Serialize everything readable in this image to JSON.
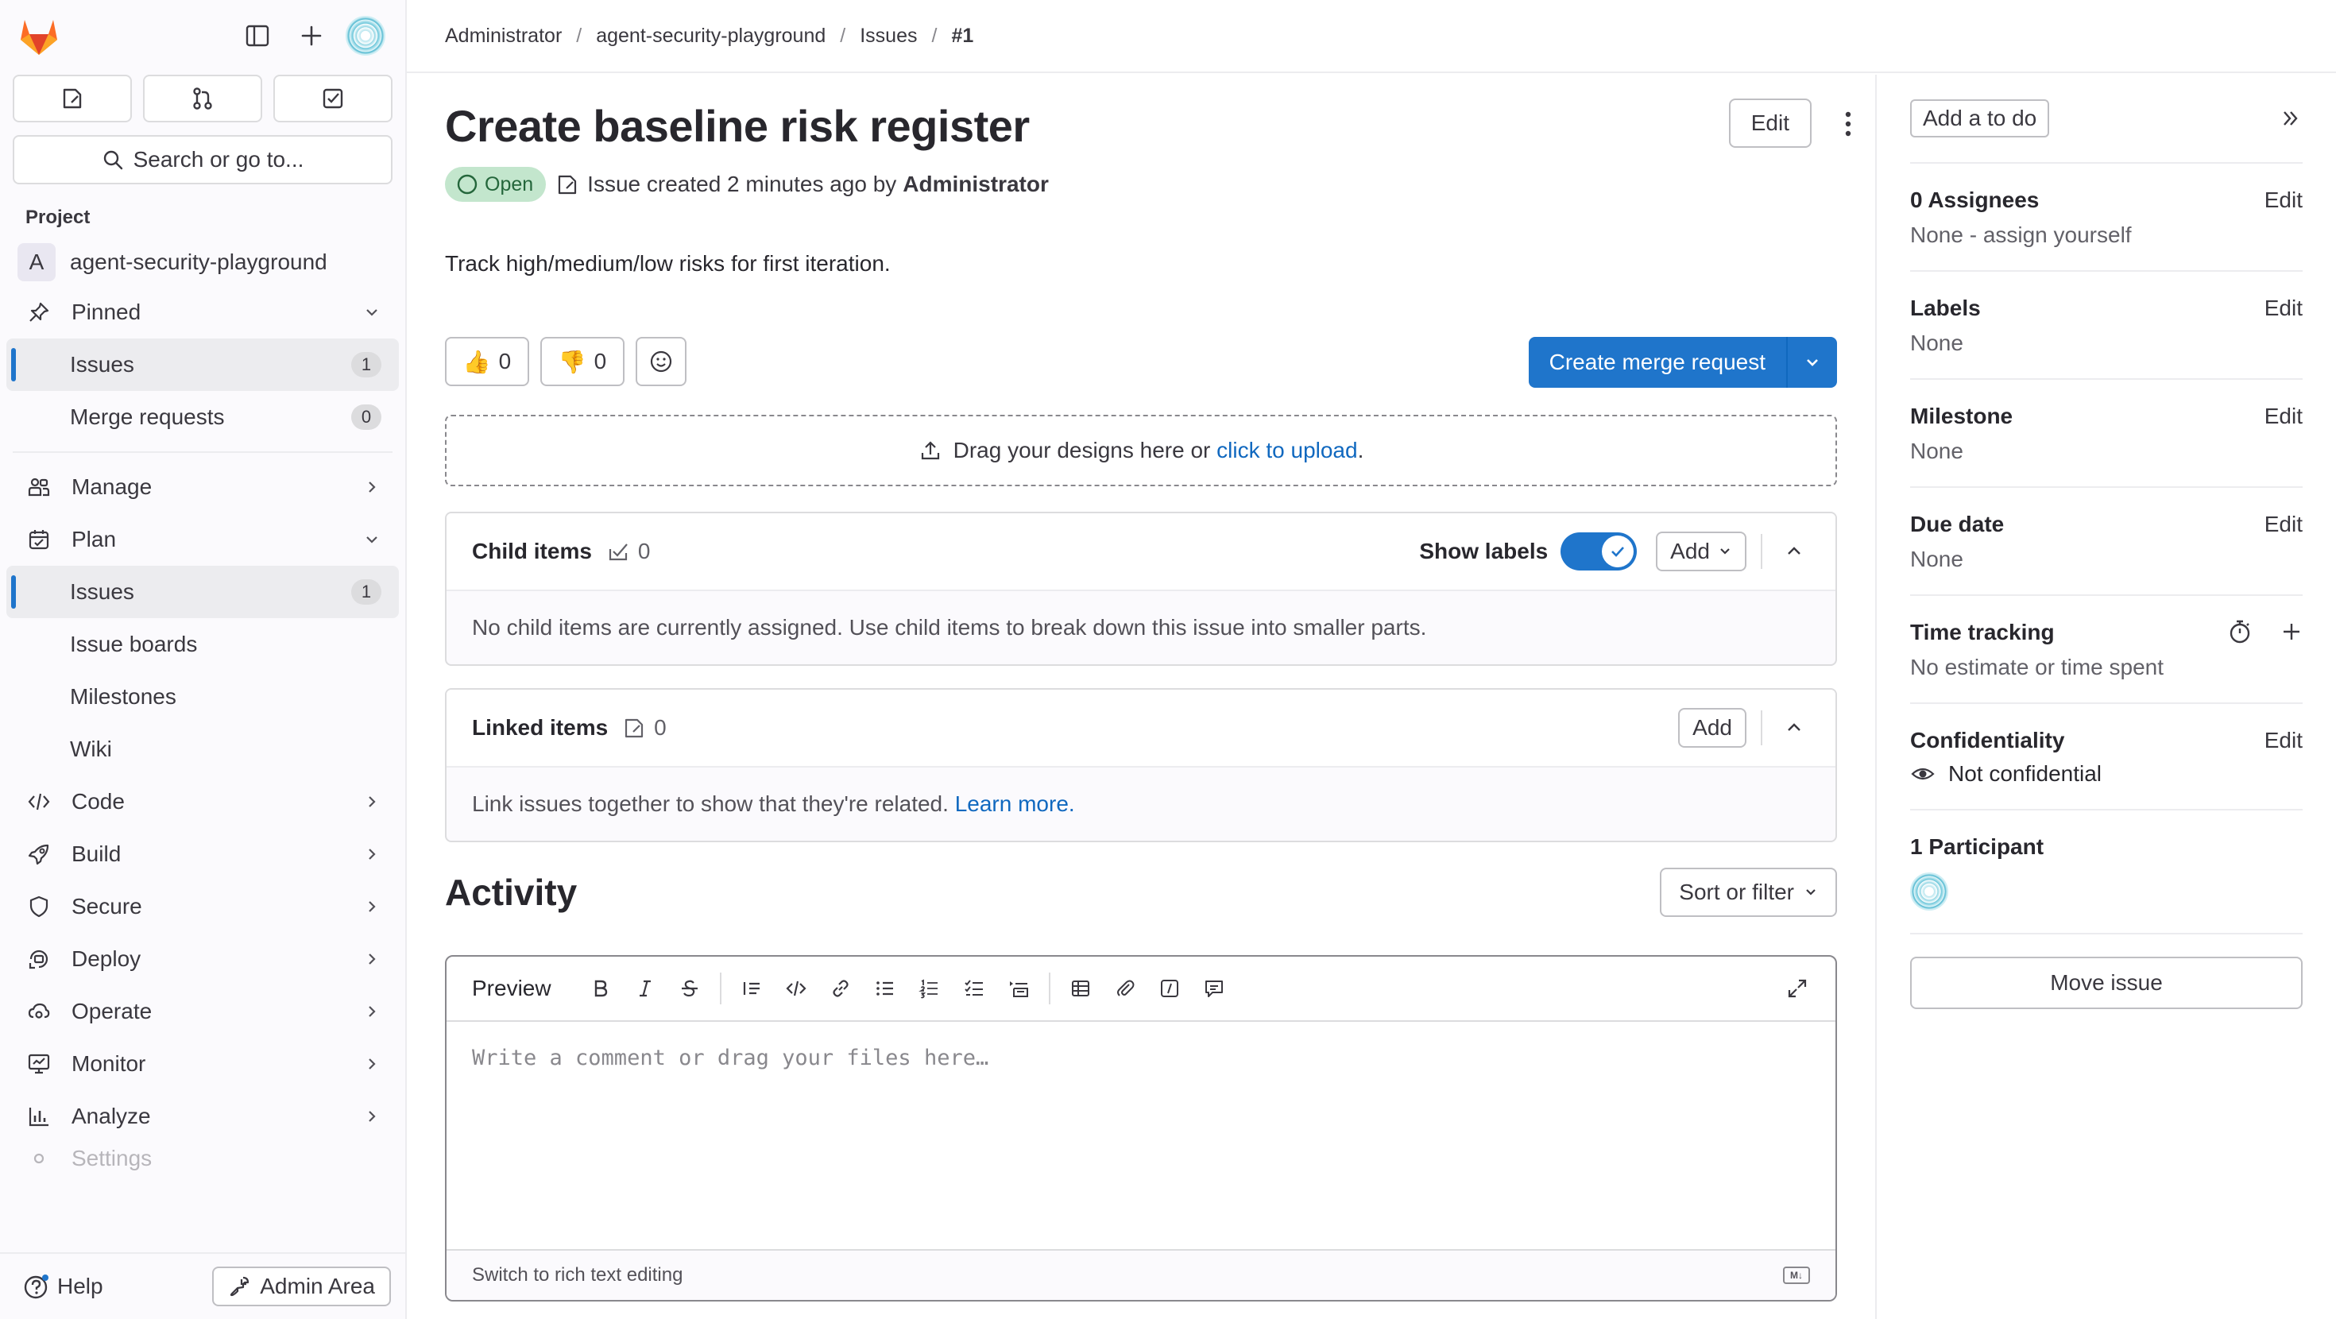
{
  "breadcrumb": [
    "Administrator",
    "agent-security-playground",
    "Issues",
    "#1"
  ],
  "sidebar": {
    "search_label": "Search or go to...",
    "section_label": "Project",
    "project_initial": "A",
    "project_name": "agent-security-playground",
    "pinned": {
      "label": "Pinned",
      "items": [
        {
          "label": "Issues",
          "count": "1"
        },
        {
          "label": "Merge requests",
          "count": "0"
        }
      ]
    },
    "manage_label": "Manage",
    "plan": {
      "label": "Plan",
      "items": [
        {
          "label": "Issues",
          "count": "1"
        },
        {
          "label": "Issue boards"
        },
        {
          "label": "Milestones"
        },
        {
          "label": "Wiki"
        }
      ]
    },
    "groups": [
      "Code",
      "Build",
      "Secure",
      "Deploy",
      "Operate",
      "Monitor",
      "Analyze",
      "Settings"
    ],
    "help_label": "Help",
    "admin_label": "Admin Area"
  },
  "issue": {
    "title": "Create baseline risk register",
    "edit_label": "Edit",
    "status": "Open",
    "meta_prefix": "Issue created 2 minutes ago by",
    "author": "Administrator",
    "description": "Track high/medium/low risks for first iteration.",
    "thumbs_up": "0",
    "thumbs_down": "0",
    "create_mr_label": "Create merge request",
    "drop_text": "Drag your designs here or",
    "drop_link": "click to upload",
    "drop_suffix": "."
  },
  "child_items": {
    "title": "Child items",
    "count": "0",
    "show_labels": "Show labels",
    "add_label": "Add",
    "empty_text": "No child items are currently assigned. Use child items to break down this issue into smaller parts."
  },
  "linked_items": {
    "title": "Linked items",
    "count": "0",
    "add_label": "Add",
    "empty_text": "Link issues together to show that they're related.",
    "learn_more": "Learn more."
  },
  "activity": {
    "title": "Activity",
    "sort_label": "Sort or filter",
    "preview_tab": "Preview",
    "placeholder": "Write a comment or drag your files here…",
    "switch_label": "Switch to rich text editing"
  },
  "right_sidebar": {
    "todo_label": "Add a to do",
    "assignees_title": "0 Assignees",
    "assignees_value": "None - assign yourself",
    "labels_title": "Labels",
    "labels_value": "None",
    "milestone_title": "Milestone",
    "milestone_value": "None",
    "due_title": "Due date",
    "due_value": "None",
    "time_title": "Time tracking",
    "time_value": "No estimate or time spent",
    "conf_title": "Confidentiality",
    "conf_value": "Not confidential",
    "participants_title": "1 Participant",
    "edit_label": "Edit",
    "move_label": "Move issue"
  },
  "colors": {
    "primary": "#1f75cb",
    "open_badge_bg": "#c3e6cd",
    "open_badge_fg": "#24663b"
  }
}
